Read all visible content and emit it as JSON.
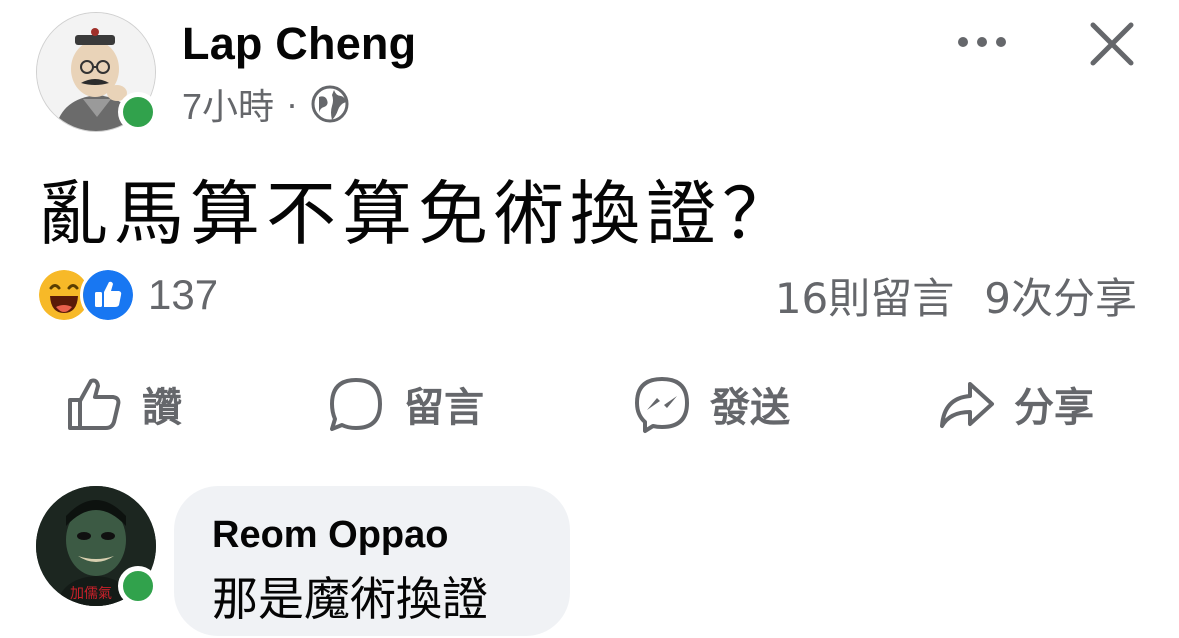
{
  "post": {
    "author": "Lap Cheng",
    "time": "7小時",
    "separator": "·",
    "privacy_icon": "globe-icon",
    "text": "亂馬算不算免術換證？",
    "more_icon": "more-options-icon",
    "close_icon": "close-icon"
  },
  "stats": {
    "reaction_icons": [
      "haha-reaction-icon",
      "like-reaction-icon"
    ],
    "reaction_count": "137",
    "comments": "16則留言",
    "shares": "9次分享"
  },
  "actions": {
    "like": "讚",
    "comment": "留言",
    "send": "發送",
    "share": "分享"
  },
  "comment": {
    "author": "Reom Oppao",
    "text": "那是魔術換證",
    "avatar_caption": "加儒氣"
  },
  "colors": {
    "online": "#31a24c",
    "secondary_text": "#65676b",
    "bubble_bg": "#f0f2f5",
    "like_blue": "#1877f2",
    "haha_yellow": "#f7b928"
  }
}
